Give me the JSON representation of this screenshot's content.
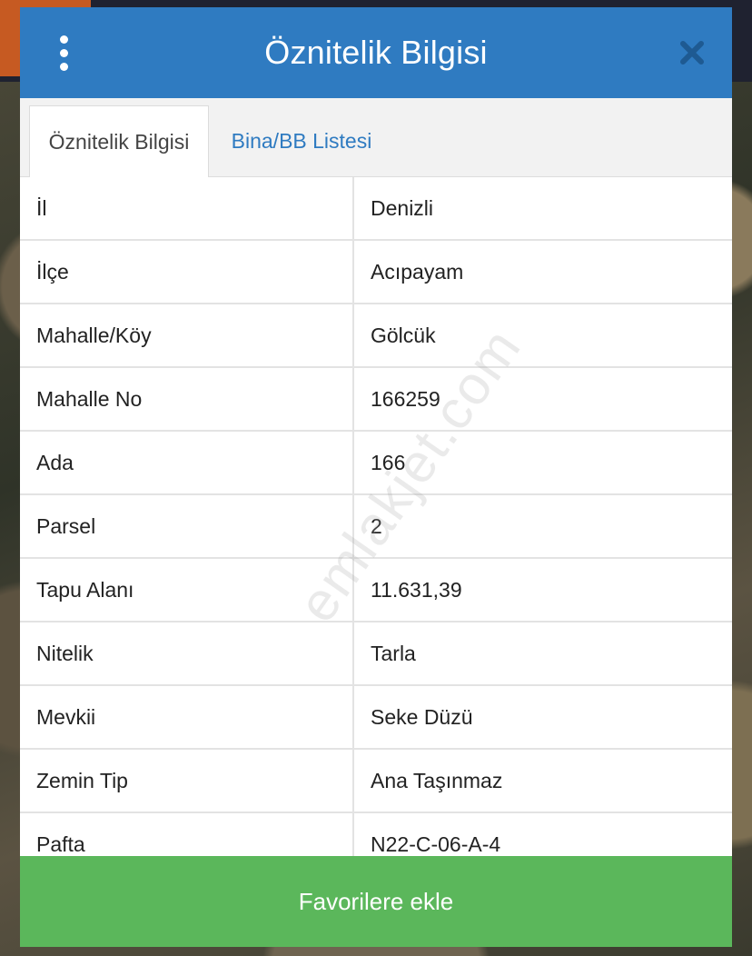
{
  "header": {
    "title": "Öznitelik Bilgisi"
  },
  "tabs": [
    {
      "label": "Öznitelik Bilgisi",
      "active": true
    },
    {
      "label": "Bina/BB Listesi",
      "active": false
    }
  ],
  "attributes": [
    {
      "key": "İl",
      "value": "Denizli"
    },
    {
      "key": "İlçe",
      "value": "Acıpayam"
    },
    {
      "key": "Mahalle/Köy",
      "value": "Gölcük"
    },
    {
      "key": "Mahalle No",
      "value": "166259"
    },
    {
      "key": "Ada",
      "value": "166"
    },
    {
      "key": "Parsel",
      "value": "2"
    },
    {
      "key": "Tapu Alanı",
      "value": "11.631,39"
    },
    {
      "key": "Nitelik",
      "value": "Tarla"
    },
    {
      "key": "Mevkii",
      "value": "Seke Düzü"
    },
    {
      "key": "Zemin Tip",
      "value": "Ana Taşınmaz"
    },
    {
      "key": "Pafta",
      "value": "N22-C-06-A-4"
    }
  ],
  "watermark": "emlakjet.com",
  "footer": {
    "button_label": "Favorilere ekle"
  },
  "colors": {
    "header": "#2f7bc1",
    "footer": "#5bb75b",
    "tab_link": "#2f7bc1"
  },
  "icons": {
    "menu": "vertical-ellipsis-icon",
    "close": "close-icon"
  }
}
